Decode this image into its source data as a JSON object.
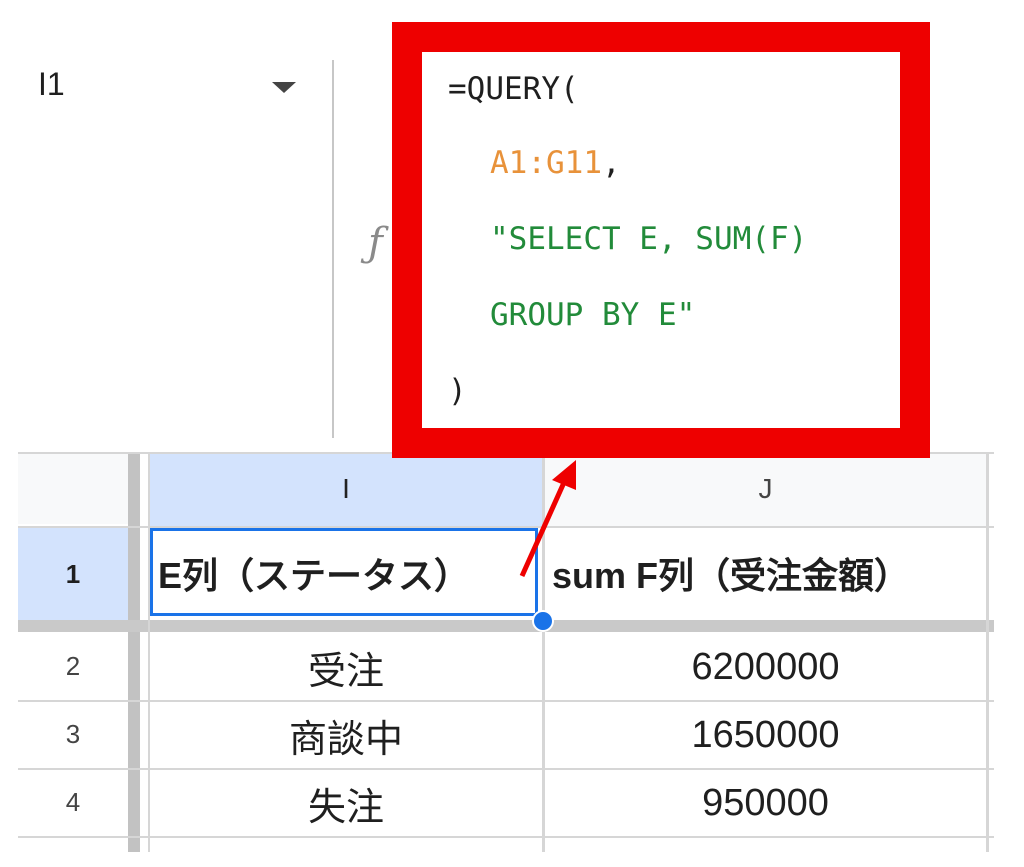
{
  "name_box": {
    "value": "I1"
  },
  "formula_bar": {
    "icon": "fx-icon",
    "lines": {
      "l1": "=QUERY(",
      "l2_range": "A1:G11",
      "l2_comma": ",",
      "l3": "\"SELECT E, SUM(F)",
      "l4": "GROUP BY E\"",
      "l5": ")"
    }
  },
  "columns": [
    "I",
    "J"
  ],
  "rows": [
    "1",
    "2",
    "3",
    "4"
  ],
  "table": {
    "header": [
      "E列（ステータス）",
      "sum F列（受注金額）"
    ],
    "body": [
      [
        "受注",
        "6200000"
      ],
      [
        "商談中",
        "1650000"
      ],
      [
        "失注",
        "950000"
      ]
    ]
  },
  "colors": {
    "callout_border": "#ee0000",
    "selection": "#1a73e8",
    "header_highlight": "#d3e3fd",
    "range_ref": "#e8923a",
    "string_literal": "#228b3a"
  }
}
